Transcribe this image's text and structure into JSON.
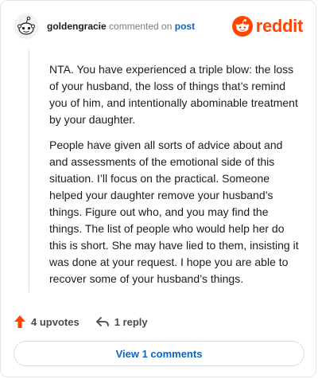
{
  "header": {
    "username": "goldengracie",
    "action_text": "commented on",
    "target_link": "post",
    "brand_name": "reddit"
  },
  "comment": {
    "paragraphs": [
      "NTA. You have experienced a triple blow: the loss of your husband, the loss of things that’s remind you of him, and intentionally abominable treatment by your daughter.",
      "People have given all sorts of advice about and and assessments of the emotional side of this situation. I’ll focus on the practical. Someone helped your daughter remove your husband’s things. Figure out who, and you may find the things. The list of people who would help her do this is short. She may have lied to them, insisting it was done at your request. I hope you are able to recover some of your husband’s things."
    ]
  },
  "actions": {
    "upvotes_label": "4 upvotes",
    "reply_label": "1 reply"
  },
  "footer": {
    "view_comments_label": "View 1 comments"
  },
  "colors": {
    "brand": "#ff4500",
    "link": "#0a66c2"
  }
}
